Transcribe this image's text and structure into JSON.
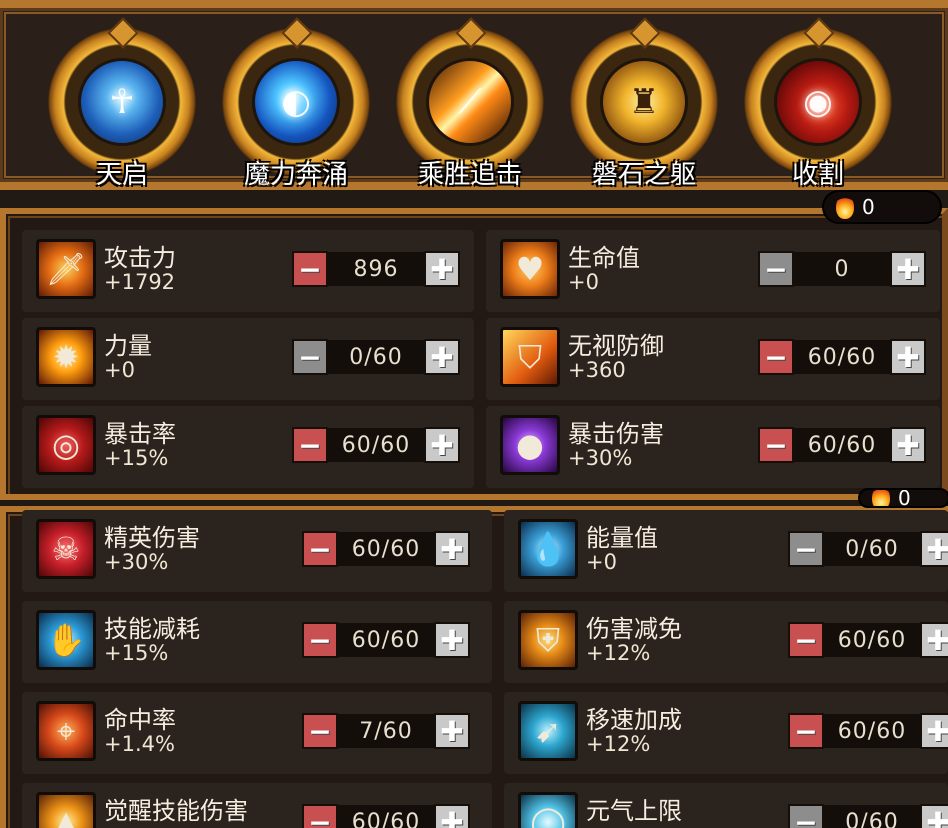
{
  "skills": [
    {
      "name": "天启",
      "icon": "figure-aura-icon"
    },
    {
      "name": "魔力奔涌",
      "icon": "mana-surge-icon"
    },
    {
      "name": "乘胜追击",
      "icon": "pursuit-slash-icon"
    },
    {
      "name": "磐石之躯",
      "icon": "stone-body-icon"
    },
    {
      "name": "收割",
      "icon": "harvest-orb-icon"
    }
  ],
  "currency": {
    "icon": "flame-icon",
    "value": "0"
  },
  "currency_bottom": {
    "icon": "flame-icon",
    "value": "0"
  },
  "stats_primary": [
    {
      "label": "攻击力",
      "bonus": "+1792",
      "value": "896",
      "icon": "sword-icon",
      "minus_active": true
    },
    {
      "label": "生命值",
      "bonus": "+0",
      "value": "0",
      "icon": "heart-icon",
      "minus_active": false
    },
    {
      "label": "力量",
      "bonus": "+0",
      "value": "0/60",
      "icon": "power-burst-icon",
      "minus_active": false
    },
    {
      "label": "无视防御",
      "bonus": "+360",
      "value": "60/60",
      "icon": "shield-pierce-icon",
      "minus_active": true
    },
    {
      "label": "暴击率",
      "bonus": "+15%",
      "value": "60/60",
      "icon": "crit-swirl-icon",
      "minus_active": true
    },
    {
      "label": "暴击伤害",
      "bonus": "+30%",
      "value": "60/60",
      "icon": "crit-orb-icon",
      "minus_active": true
    }
  ],
  "stats_secondary": [
    {
      "label": "精英伤害",
      "bonus": "+30%",
      "value": "60/60",
      "icon": "demon-skull-icon",
      "minus_active": true
    },
    {
      "label": "能量值",
      "bonus": "+0",
      "value": "0/60",
      "icon": "energy-drop-icon",
      "minus_active": false
    },
    {
      "label": "技能减耗",
      "bonus": "+15%",
      "value": "60/60",
      "icon": "skill-hands-icon",
      "minus_active": true
    },
    {
      "label": "伤害减免",
      "bonus": "+12%",
      "value": "60/60",
      "icon": "shield-icon",
      "minus_active": true
    },
    {
      "label": "命中率",
      "bonus": "+1.4%",
      "value": "7/60",
      "icon": "crosshair-icon",
      "minus_active": true
    },
    {
      "label": "移速加成",
      "bonus": "+12%",
      "value": "60/60",
      "icon": "speed-boot-icon",
      "minus_active": true
    },
    {
      "label": "觉醒技能伤害",
      "bonus": "",
      "value": "60/60",
      "icon": "awaken-flame-icon",
      "minus_active": true
    },
    {
      "label": "元气上限",
      "bonus": "",
      "value": "0/60",
      "icon": "vital-ring-icon",
      "minus_active": false
    }
  ],
  "button_minus": "−",
  "button_plus": "✚"
}
